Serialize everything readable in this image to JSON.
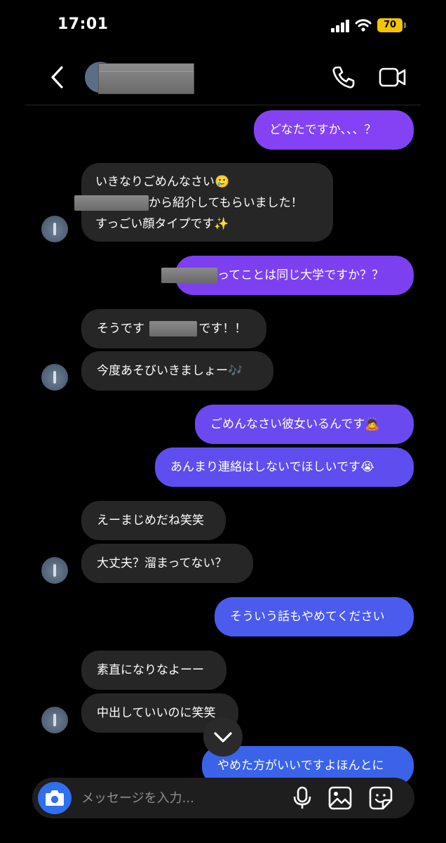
{
  "status_bar": {
    "time": "17:01",
    "battery": "70"
  },
  "header": {
    "contact_name": "",
    "icons": [
      "chevron-left-icon",
      "phone-icon",
      "video-camera-icon"
    ]
  },
  "messages": [
    {
      "from": "them",
      "lines": [
        "どなたですか、、、？"
      ]
    },
    {
      "from": "them",
      "lines": [
        "いきなりごめんなさい🥲",
        "から紹介してもらいました！",
        "すっごい顔タイプです✨"
      ]
    },
    {
      "from": "me",
      "text": "ってことは同じ大学ですか？？"
    },
    {
      "from": "them",
      "a": "そうです",
      "b": "です！！"
    },
    {
      "from": "them",
      "text": "今度あそびいきましょー🎶"
    },
    {
      "from": "me",
      "text": "ごめんなさい彼女いるんです🙇"
    },
    {
      "from": "me",
      "text": "あんまり連絡はしないでほしいです😭"
    },
    {
      "from": "them",
      "text": "えーまじめだね笑笑"
    },
    {
      "from": "them",
      "text": "大丈夫？溜まってない？"
    },
    {
      "from": "me",
      "text": "そういう話もやめてください"
    },
    {
      "from": "them",
      "text": "素直になりなよーー"
    },
    {
      "from": "them",
      "text": "中出していいのに笑笑"
    },
    {
      "from": "me",
      "text": "やめた方がいいですよほんとに"
    }
  ],
  "composer": {
    "placeholder": "メッセージを入力..."
  },
  "colors": {
    "background": "#000000",
    "incoming_bubble": "#262626",
    "outgoing_purple": "#7b3ff0",
    "outgoing_blue": "#3a63ea",
    "camera_button": "#2f6ff0",
    "battery": "#f5c400"
  }
}
